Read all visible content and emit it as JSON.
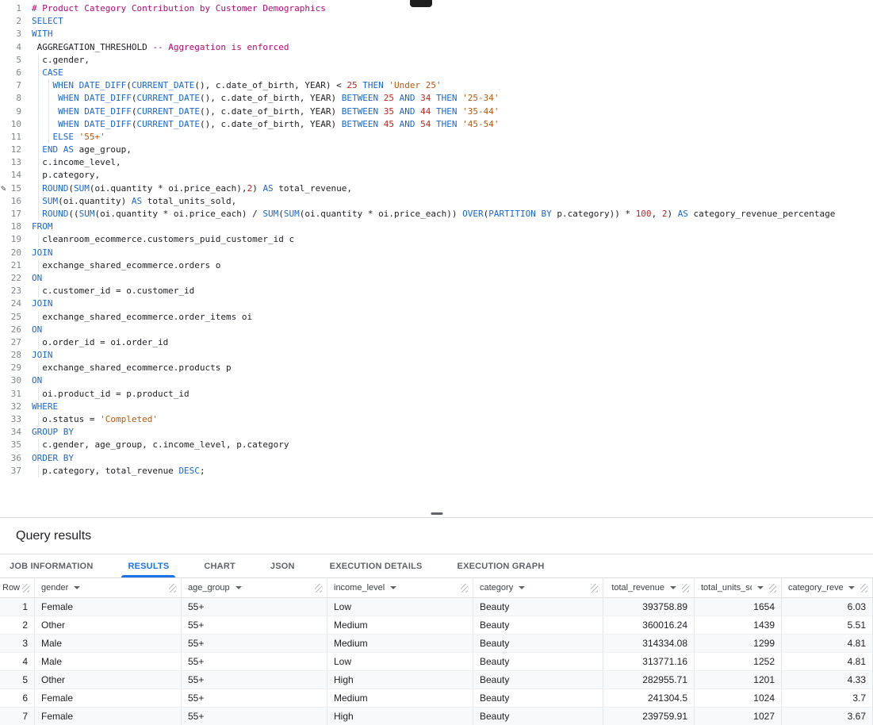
{
  "editor": {
    "pencil_line": 15,
    "lines": [
      [
        [
          "c",
          "# Product Category Contribution by Customer Demographics"
        ]
      ],
      [
        [
          "k",
          "SELECT"
        ]
      ],
      [
        [
          "k",
          "WITH"
        ]
      ],
      [
        [
          "t",
          " AGGREGATION_THRESHOLD "
        ],
        [
          "c",
          "-- Aggregation is enforced"
        ]
      ],
      [
        [
          "t",
          "  c.gender,"
        ]
      ],
      [
        [
          "t",
          "  "
        ],
        [
          "k",
          "CASE"
        ]
      ],
      [
        [
          "t",
          "    "
        ],
        [
          "k",
          "WHEN"
        ],
        [
          "t",
          " "
        ],
        [
          "k",
          "DATE_DIFF"
        ],
        [
          "t",
          "("
        ],
        [
          "k",
          "CURRENT_DATE"
        ],
        [
          "t",
          "(), c.date_of_birth, YEAR) < "
        ],
        [
          "n",
          "25"
        ],
        [
          "t",
          " "
        ],
        [
          "k",
          "THEN"
        ],
        [
          "t",
          " "
        ],
        [
          "s",
          "'Under 25'"
        ]
      ],
      [
        [
          "t",
          "     "
        ],
        [
          "k",
          "WHEN"
        ],
        [
          "t",
          " "
        ],
        [
          "k",
          "DATE_DIFF"
        ],
        [
          "t",
          "("
        ],
        [
          "k",
          "CURRENT_DATE"
        ],
        [
          "t",
          "(), c.date_of_birth, YEAR) "
        ],
        [
          "k",
          "BETWEEN"
        ],
        [
          "t",
          " "
        ],
        [
          "n",
          "25"
        ],
        [
          "t",
          " "
        ],
        [
          "k",
          "AND"
        ],
        [
          "t",
          " "
        ],
        [
          "n",
          "34"
        ],
        [
          "t",
          " "
        ],
        [
          "k",
          "THEN"
        ],
        [
          "t",
          " "
        ],
        [
          "s",
          "'25-34'"
        ]
      ],
      [
        [
          "t",
          "     "
        ],
        [
          "k",
          "WHEN"
        ],
        [
          "t",
          " "
        ],
        [
          "k",
          "DATE_DIFF"
        ],
        [
          "t",
          "("
        ],
        [
          "k",
          "CURRENT_DATE"
        ],
        [
          "t",
          "(), c.date_of_birth, YEAR) "
        ],
        [
          "k",
          "BETWEEN"
        ],
        [
          "t",
          " "
        ],
        [
          "n",
          "35"
        ],
        [
          "t",
          " "
        ],
        [
          "k",
          "AND"
        ],
        [
          "t",
          " "
        ],
        [
          "n",
          "44"
        ],
        [
          "t",
          " "
        ],
        [
          "k",
          "THEN"
        ],
        [
          "t",
          " "
        ],
        [
          "s",
          "'35-44'"
        ]
      ],
      [
        [
          "t",
          "     "
        ],
        [
          "k",
          "WHEN"
        ],
        [
          "t",
          " "
        ],
        [
          "k",
          "DATE_DIFF"
        ],
        [
          "t",
          "("
        ],
        [
          "k",
          "CURRENT_DATE"
        ],
        [
          "t",
          "(), c.date_of_birth, YEAR) "
        ],
        [
          "k",
          "BETWEEN"
        ],
        [
          "t",
          " "
        ],
        [
          "n",
          "45"
        ],
        [
          "t",
          " "
        ],
        [
          "k",
          "AND"
        ],
        [
          "t",
          " "
        ],
        [
          "n",
          "54"
        ],
        [
          "t",
          " "
        ],
        [
          "k",
          "THEN"
        ],
        [
          "t",
          " "
        ],
        [
          "s",
          "'45-54'"
        ]
      ],
      [
        [
          "t",
          "    "
        ],
        [
          "k",
          "ELSE"
        ],
        [
          "t",
          " "
        ],
        [
          "s",
          "'55+'"
        ]
      ],
      [
        [
          "t",
          "  "
        ],
        [
          "k",
          "END"
        ],
        [
          "t",
          " "
        ],
        [
          "k",
          "AS"
        ],
        [
          "t",
          " age_group,"
        ]
      ],
      [
        [
          "t",
          "  c.income_level,"
        ]
      ],
      [
        [
          "t",
          "  p.category,"
        ]
      ],
      [
        [
          "t",
          "  "
        ],
        [
          "k",
          "ROUND"
        ],
        [
          "t",
          "("
        ],
        [
          "k",
          "SUM"
        ],
        [
          "t",
          "(oi.quantity * oi.price_each),"
        ],
        [
          "n",
          "2"
        ],
        [
          "t",
          ") "
        ],
        [
          "k",
          "AS"
        ],
        [
          "t",
          " total_revenue,"
        ]
      ],
      [
        [
          "t",
          "  "
        ],
        [
          "k",
          "SUM"
        ],
        [
          "t",
          "(oi.quantity) "
        ],
        [
          "k",
          "AS"
        ],
        [
          "t",
          " total_units_sold,"
        ]
      ],
      [
        [
          "t",
          "  "
        ],
        [
          "k",
          "ROUND"
        ],
        [
          "t",
          "(("
        ],
        [
          "k",
          "SUM"
        ],
        [
          "t",
          "(oi.quantity * oi.price_each) / "
        ],
        [
          "k",
          "SUM"
        ],
        [
          "t",
          "("
        ],
        [
          "k",
          "SUM"
        ],
        [
          "t",
          "(oi.quantity * oi.price_each)) "
        ],
        [
          "k",
          "OVER"
        ],
        [
          "t",
          "("
        ],
        [
          "k",
          "PARTITION BY"
        ],
        [
          "t",
          " p.category)) * "
        ],
        [
          "n",
          "100"
        ],
        [
          "t",
          ", "
        ],
        [
          "n",
          "2"
        ],
        [
          "t",
          ") "
        ],
        [
          "k",
          "AS"
        ],
        [
          "t",
          " category_revenue_percentage"
        ]
      ],
      [
        [
          "k",
          "FROM"
        ]
      ],
      [
        [
          "t",
          "  cleanroom_ecommerce.customers_puid_customer_id c"
        ]
      ],
      [
        [
          "k",
          "JOIN"
        ]
      ],
      [
        [
          "t",
          "  exchange_shared_ecommerce.orders o"
        ]
      ],
      [
        [
          "k",
          "ON"
        ]
      ],
      [
        [
          "t",
          "  c.customer_id = o.customer_id"
        ]
      ],
      [
        [
          "k",
          "JOIN"
        ]
      ],
      [
        [
          "t",
          "  exchange_shared_ecommerce.order_items oi"
        ]
      ],
      [
        [
          "k",
          "ON"
        ]
      ],
      [
        [
          "t",
          "  o.order_id = oi.order_id"
        ]
      ],
      [
        [
          "k",
          "JOIN"
        ]
      ],
      [
        [
          "t",
          "  exchange_shared_ecommerce.products p"
        ]
      ],
      [
        [
          "k",
          "ON"
        ]
      ],
      [
        [
          "t",
          "  oi.product_id = p.product_id"
        ]
      ],
      [
        [
          "k",
          "WHERE"
        ]
      ],
      [
        [
          "t",
          "  o.status = "
        ],
        [
          "s",
          "'Completed'"
        ]
      ],
      [
        [
          "k",
          "GROUP BY"
        ]
      ],
      [
        [
          "t",
          "  c.gender, age_group, c.income_level, p.category"
        ]
      ],
      [
        [
          "k",
          "ORDER BY"
        ]
      ],
      [
        [
          "t",
          "  p.category, total_revenue "
        ],
        [
          "k",
          "DESC"
        ],
        [
          "t",
          ";"
        ]
      ]
    ]
  },
  "results_panel": {
    "title": "Query results",
    "tabs": [
      {
        "label": "JOB INFORMATION",
        "active": false
      },
      {
        "label": "RESULTS",
        "active": true
      },
      {
        "label": "CHART",
        "active": false
      },
      {
        "label": "JSON",
        "active": false
      },
      {
        "label": "EXECUTION DETAILS",
        "active": false
      },
      {
        "label": "EXECUTION GRAPH",
        "active": false
      }
    ],
    "table": {
      "columns": [
        {
          "key": "row",
          "label": "Row",
          "align": "left",
          "menu": false
        },
        {
          "key": "gender",
          "label": "gender",
          "align": "left",
          "menu": true
        },
        {
          "key": "age_group",
          "label": "age_group",
          "align": "left",
          "menu": true
        },
        {
          "key": "income_level",
          "label": "income_level",
          "align": "left",
          "menu": true
        },
        {
          "key": "category",
          "label": "category",
          "align": "left",
          "menu": true
        },
        {
          "key": "total_revenue",
          "label": "total_revenue",
          "align": "right",
          "menu": true
        },
        {
          "key": "total_units_sold",
          "label": "total_units_sold",
          "align": "right",
          "menu": true
        },
        {
          "key": "category_revenue_percentage",
          "label": "category_revenue_percentage",
          "align": "right",
          "menu": true
        }
      ],
      "rows": [
        [
          "1",
          "Female",
          "55+",
          "Low",
          "Beauty",
          "393758.89",
          "1654",
          "6.03"
        ],
        [
          "2",
          "Other",
          "55+",
          "Medium",
          "Beauty",
          "360016.24",
          "1439",
          "5.51"
        ],
        [
          "3",
          "Male",
          "55+",
          "Medium",
          "Beauty",
          "314334.08",
          "1299",
          "4.81"
        ],
        [
          "4",
          "Male",
          "55+",
          "Low",
          "Beauty",
          "313771.16",
          "1252",
          "4.81"
        ],
        [
          "5",
          "Other",
          "55+",
          "High",
          "Beauty",
          "282955.71",
          "1201",
          "4.33"
        ],
        [
          "6",
          "Female",
          "55+",
          "Medium",
          "Beauty",
          "241304.5",
          "1024",
          "3.7"
        ],
        [
          "7",
          "Female",
          "55+",
          "High",
          "Beauty",
          "239759.91",
          "1027",
          "3.67"
        ]
      ]
    }
  },
  "colors": {
    "keyword": "#1967d2",
    "string": "#b5590d",
    "number": "#c5221f",
    "comment": "#b80672",
    "identifier": "#202124",
    "line_number": "#80868b",
    "tab_active": "#1a73e8",
    "tab_inactive": "#5f6368"
  }
}
